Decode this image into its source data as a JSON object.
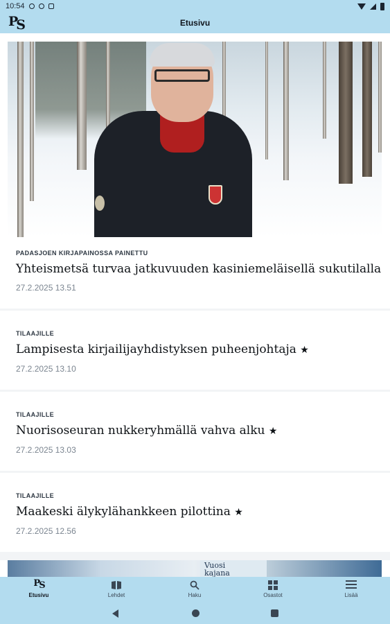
{
  "status_bar": {
    "time": "10:54"
  },
  "app_bar": {
    "logo": {
      "p": "P",
      "s": "S"
    },
    "title": "Etusivu"
  },
  "hero": {
    "image": "forest-portrait-photo"
  },
  "articles": [
    {
      "kicker": "PADASJOEN KIRJAPAINOSSA PAINETTU",
      "headline": "Yhteismetsä turvaa jatkuvuuden kasiniemeläisellä sukutilalla",
      "star": "",
      "date": "27.2.2025 13.51"
    },
    {
      "kicker": "TILAAJILLE",
      "headline": "Lampisesta kirjailijayhdistyksen puheenjohtaja",
      "star": "★",
      "date": "27.2.2025 13.10"
    },
    {
      "kicker": "TILAAJILLE",
      "headline": "Nuorisoseuran nukkeryhmällä vahva alku",
      "star": "★",
      "date": "27.2.2025 13.03"
    },
    {
      "kicker": "TILAAJILLE",
      "headline": "Maakeski älykylähankkeen pilottina",
      "star": "★",
      "date": "27.2.2025 12.56"
    }
  ],
  "peek": {
    "sign_text": "Vuosi\nkajana"
  },
  "bottom_nav": [
    {
      "label": "Etusivu",
      "icon": "ps-logo-icon",
      "active": true
    },
    {
      "label": "Lehdet",
      "icon": "book-icon",
      "active": false
    },
    {
      "label": "Haku",
      "icon": "search-icon",
      "active": false
    },
    {
      "label": "Osastot",
      "icon": "grid-icon",
      "active": false
    },
    {
      "label": "Lisää",
      "icon": "menu-icon",
      "active": false
    }
  ],
  "colors": {
    "bar_bg": "#b3dcef",
    "text_dark": "#0e1216",
    "text_muted": "#7b8590",
    "content_bg": "#f2f4f6"
  }
}
